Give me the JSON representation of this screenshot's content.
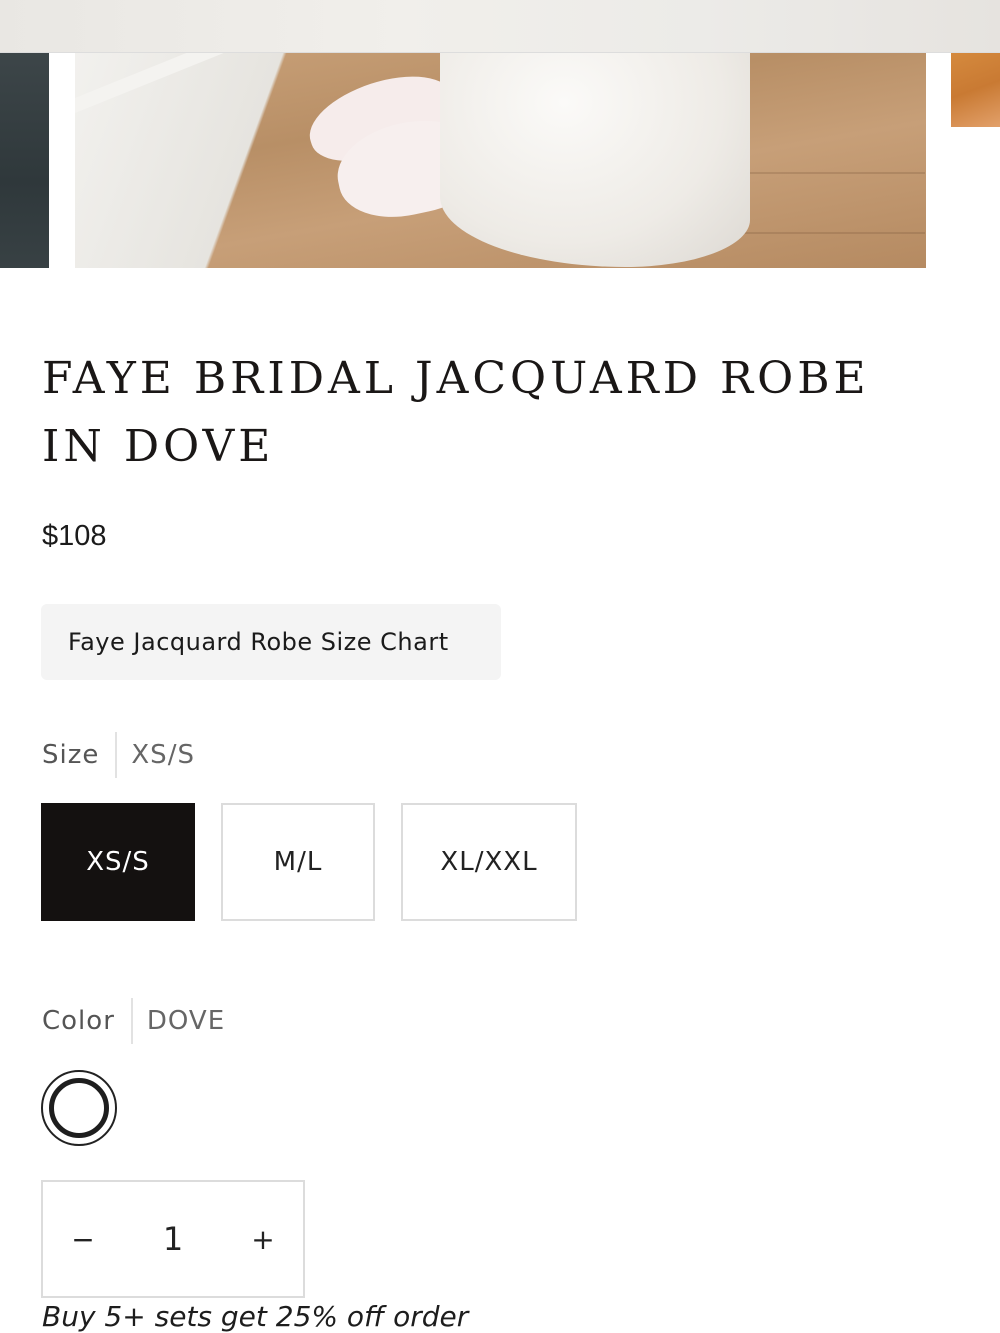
{
  "product": {
    "title": "FAYE BRIDAL JACQUARD ROBE IN DOVE",
    "price": "$108"
  },
  "size_chart": {
    "label": "Faye Jacquard Robe Size Chart"
  },
  "size": {
    "label": "Size",
    "selected": "XS/S",
    "options": [
      "XS/S",
      "M/L",
      "XL/XXL"
    ]
  },
  "color": {
    "label": "Color",
    "selected": "DOVE",
    "swatch_color": "#ffffff"
  },
  "quantity": {
    "decrement": "−",
    "value": "1",
    "increment": "+"
  },
  "promo": {
    "text": "Buy 5+ sets get 25% off order"
  },
  "colors": {
    "selected_bg": "#141110",
    "border": "#dcdcdc",
    "chart_button_bg": "#f4f4f4"
  }
}
